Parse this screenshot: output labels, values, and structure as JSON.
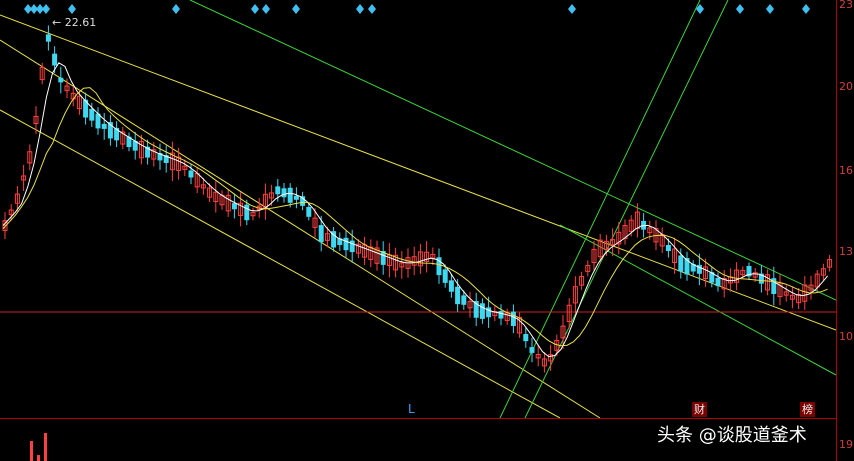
{
  "chart": {
    "peak_label": "← 22.61",
    "axis_labels": [
      "23",
      "20",
      "16",
      "13",
      "10",
      "19"
    ],
    "markers": {
      "L": "L",
      "cai": "财",
      "bang": "榜"
    },
    "watermark": "头条 @谈股道釜术",
    "colors": {
      "up": "#ff4040",
      "down": "#40d8f0",
      "ma5": "#ffffff",
      "ma10": "#e8e04a",
      "channel_yellow": "#e8e04a",
      "channel_green": "#3cd23c",
      "support": "#d02020",
      "diamond": "#40c0f0"
    },
    "icons": [
      "diamond-signal-icon"
    ]
  }
}
